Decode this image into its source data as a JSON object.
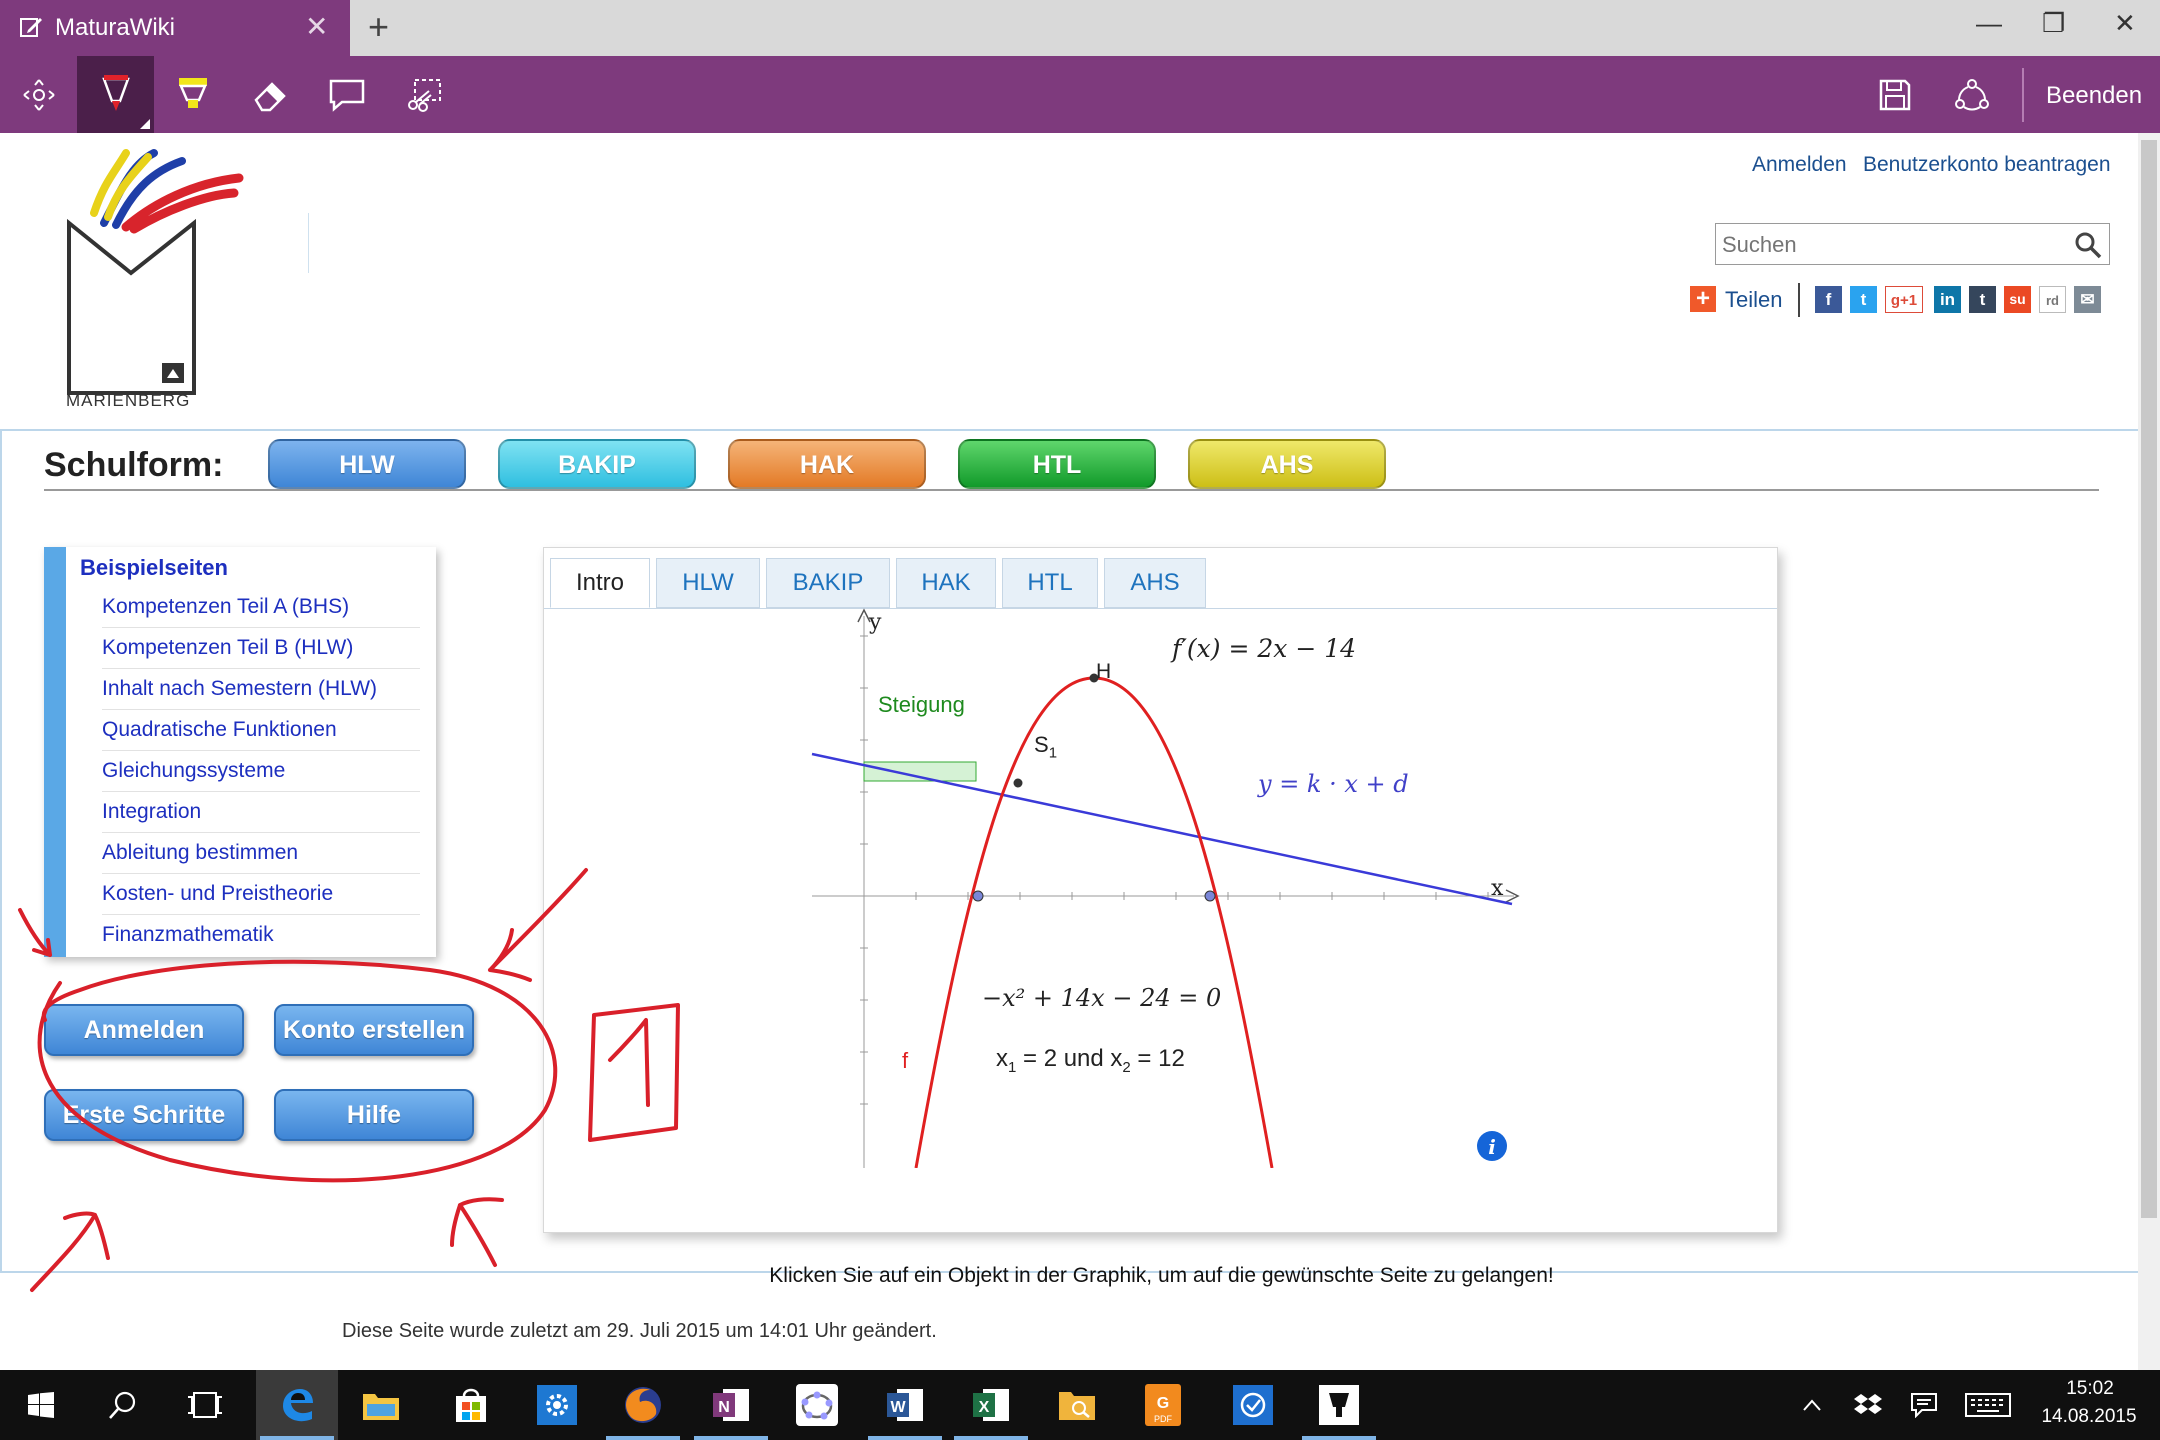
{
  "browser": {
    "tab_title": "MaturaWiki",
    "tab_icon": "edit-note-icon",
    "new_tab_label": "+",
    "window": {
      "minimize": "—",
      "restore": "❐",
      "close": "✕"
    }
  },
  "ink_toolbar": {
    "tools": [
      "pan-icon",
      "ballpoint-pen-icon",
      "highlighter-icon",
      "eraser-icon",
      "comment-icon",
      "clip-icon"
    ],
    "active_tool": "ballpoint-pen-icon",
    "right_tools": [
      "save-icon",
      "share-icon"
    ],
    "finish_label": "Beenden",
    "accent": "#7e3a7d"
  },
  "header": {
    "logo_text": "MARIENBERG",
    "links": {
      "login": "Anmelden",
      "request_account": "Benutzerkonto beantragen"
    },
    "search": {
      "placeholder": "Suchen",
      "value": ""
    },
    "share": {
      "label": "Teilen",
      "networks": [
        "f",
        "t",
        "g+1",
        "in",
        "t",
        "su",
        "rd",
        "✉"
      ]
    }
  },
  "schulform": {
    "label": "Schulform:",
    "buttons": [
      {
        "label": "HLW",
        "color": "#4a8fde"
      },
      {
        "label": "BAKIP",
        "color": "#3bc9e6"
      },
      {
        "label": "HAK",
        "color": "#ea8a3a"
      },
      {
        "label": "HTL",
        "color": "#22a83a"
      },
      {
        "label": "AHS",
        "color": "#d9cf2a"
      }
    ]
  },
  "sidebar": {
    "title": "Beispielseiten",
    "items": [
      "Kompetenzen Teil A (BHS)",
      "Kompetenzen Teil B (HLW)",
      "Inhalt nach Semestern (HLW)",
      "Quadratische Funktionen",
      "Gleichungssysteme",
      "Integration",
      "Ableitung bestimmen",
      "Kosten- und Preistheorie",
      "Finanzmathematik"
    ]
  },
  "actions": {
    "login": "Anmelden",
    "create_account": "Konto erstellen",
    "first_steps": "Erste Schritte",
    "help": "Hilfe"
  },
  "graph_panel": {
    "tabs": [
      "Intro",
      "HLW",
      "BAKIP",
      "HAK",
      "HTL",
      "AHS"
    ],
    "active_tab": "Intro",
    "labels": {
      "y_axis": "y",
      "x_axis": "x",
      "derivative": "f′(x) = 2x − 14",
      "maximum": "H",
      "slope": "Steigung",
      "intersection": "S",
      "intersection_sub": "1",
      "line": "y = k · x + d",
      "function": "f",
      "equation": "−x² + 14x − 24 = 0",
      "roots_a": "x",
      "roots_a_sub": "1",
      "roots_a_val": " = 2 und ",
      "roots_b": "x",
      "roots_b_sub": "2",
      "roots_b_val": " = 12"
    },
    "caption": "Klicken Sie auf ein Objekt in der Graphik, um auf die gewünschte Seite zu gelangen!",
    "info_icon": "info-icon"
  },
  "footer": {
    "last_modified": "Diese Seite wurde zuletzt am 29. Juli 2015 um 14:01 Uhr geändert."
  },
  "annotation": {
    "number": "1",
    "ink_color": "#d9202a"
  },
  "taskbar": {
    "apps": [
      "start-icon",
      "search-icon",
      "task-view-icon",
      "edge-icon",
      "file-explorer-icon",
      "store-icon",
      "settings-icon",
      "firefox-icon",
      "onenote-icon",
      "geogebra-icon",
      "word-icon",
      "excel-icon",
      "folder-search-icon",
      "pdf-icon",
      "todo-icon",
      "ink-app-icon"
    ],
    "time": "15:02",
    "date": "14.08.2015"
  }
}
